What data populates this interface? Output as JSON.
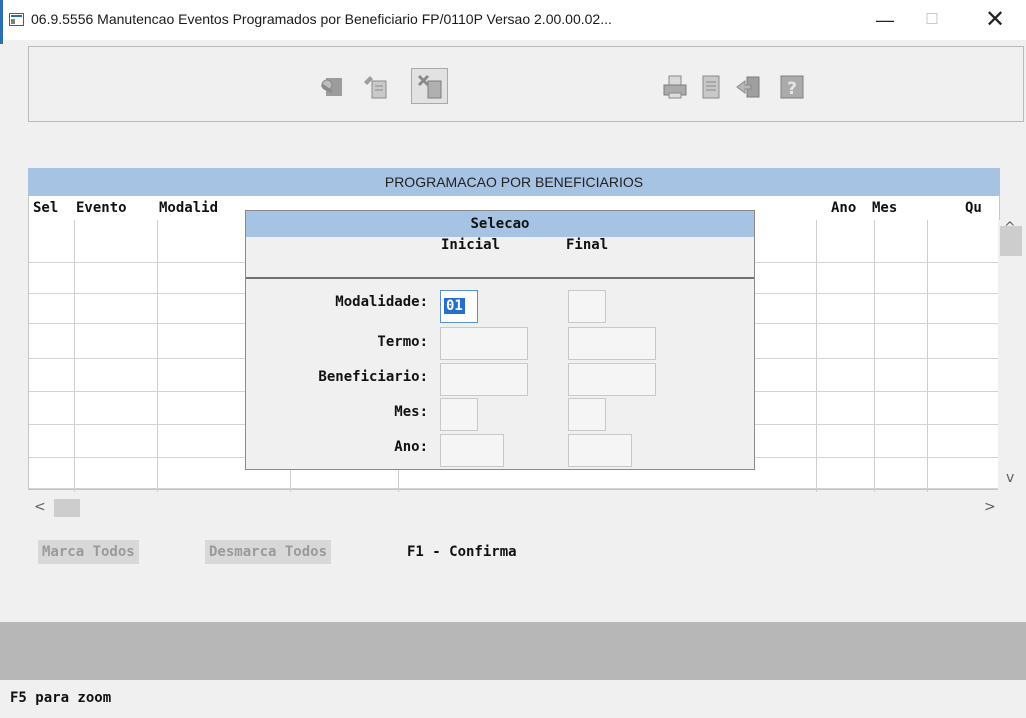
{
  "window": {
    "title": "06.9.5556 Manutencao Eventos Programados por Beneficiario FP/0110P Versao 2.00.00.02...",
    "minimize": "—",
    "maximize": "☐",
    "close": "✕"
  },
  "toolbar": {
    "buttons": [
      "key-icon",
      "edit-record-icon",
      "delete-record-icon",
      "print-icon",
      "document-icon",
      "exit-icon",
      "help-icon"
    ]
  },
  "grid": {
    "caption": "PROGRAMACAO POR BENEFICIARIOS",
    "columns": [
      "Sel",
      "Evento",
      "Modalid",
      "Ano",
      "Mes",
      "Qu"
    ],
    "rows": 8
  },
  "dialog": {
    "title": "Selecao",
    "col_initial": "Inicial",
    "col_final": "Final",
    "fields": [
      {
        "label": "Modalidade:",
        "initial": "01",
        "final": ""
      },
      {
        "label": "Termo:",
        "initial": "",
        "final": ""
      },
      {
        "label": "Beneficiario:",
        "initial": "",
        "final": ""
      },
      {
        "label": "Mes:",
        "initial": "",
        "final": ""
      },
      {
        "label": "Ano:",
        "initial": "",
        "final": ""
      }
    ]
  },
  "actions": {
    "mark_all": "Marca Todos",
    "unmark_all": "Desmarca Todos",
    "confirm_hint": "F1 - Confirma"
  },
  "status": {
    "hint": "F5 para zoom"
  },
  "scroll": {
    "up": "^",
    "down": "v",
    "left": "<",
    "right": ">"
  }
}
